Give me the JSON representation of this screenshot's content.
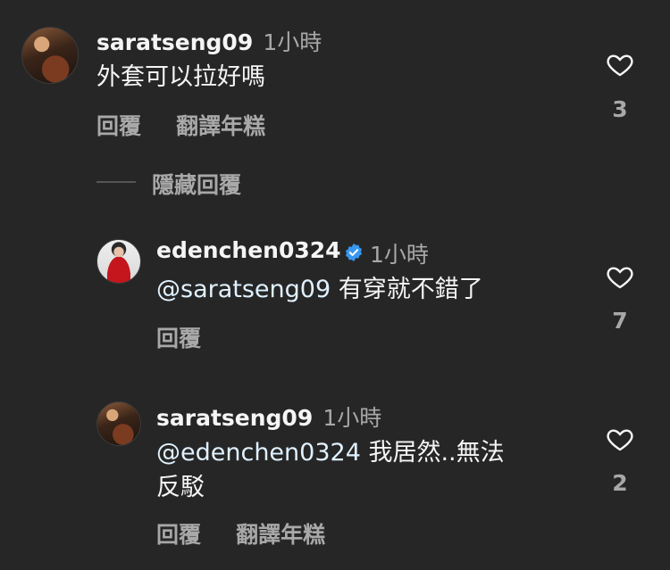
{
  "comments": [
    {
      "username": "saratseng09",
      "time": "1小時",
      "text": "外套可以拉好嗎",
      "actions": [
        "回覆",
        "翻譯年糕"
      ],
      "likes": "3"
    }
  ],
  "hide_replies": "隱藏回覆",
  "replies": [
    {
      "username": "edenchen0324",
      "verified": true,
      "time": "1小時",
      "mention": "@saratseng09",
      "text": " 有穿就不錯了",
      "actions": [
        "回覆"
      ],
      "likes": "7"
    },
    {
      "username": "saratseng09",
      "time": "1小時",
      "mention": "@edenchen0324",
      "text_line1": " 我居然..無法",
      "text_line2": "反駁",
      "actions": [
        "回覆",
        "翻譯年糕"
      ],
      "likes": "2"
    }
  ],
  "colors": {
    "background": "#262626",
    "secondary_text": "#a8a8a8",
    "mention": "#e0f1ff",
    "verified_badge": "#3897f0"
  },
  "icons": [
    "heart-icon",
    "verified-badge-icon"
  ]
}
